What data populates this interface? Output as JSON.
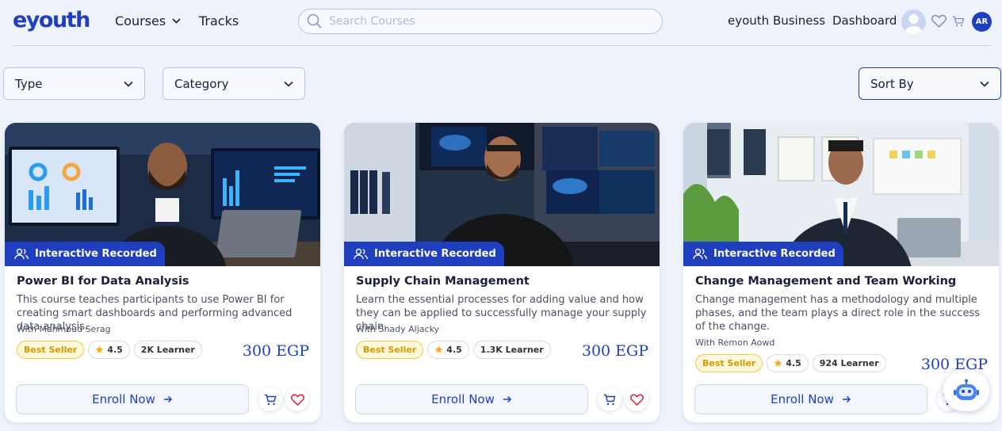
{
  "header": {
    "logo": "eyouth",
    "nav_courses": "Courses",
    "nav_tracks": "Tracks",
    "search_placeholder": "Search Courses",
    "business": "eyouth Business",
    "dashboard": "Dashboard",
    "user_initials": "AR"
  },
  "filters": {
    "type": "Type",
    "category": "Category",
    "sort": "Sort By"
  },
  "courses": [
    {
      "badge": "Interactive Recorded",
      "title": "Power BI for Data Analysis",
      "description": "This course teaches participants to use Power BI for creating smart dashboards and performing advanced data analysis.",
      "instructor": "With Mahmoud Serag",
      "tag": "Best Seller",
      "rating": "4.5",
      "learners": "2K Learner",
      "price": "300 EGP",
      "enroll": "Enroll Now"
    },
    {
      "badge": "Interactive Recorded",
      "title": "Supply Chain Management",
      "description": "Learn the essential processes for adding value and how they can be applied to successfully manage your supply chain.",
      "instructor": "With Shady Aljacky",
      "tag": "Best Seller",
      "rating": "4.5",
      "learners": "1.3K Learner",
      "price": "300 EGP",
      "enroll": "Enroll Now"
    },
    {
      "badge": "Interactive Recorded",
      "title": "Change Management and Team Working",
      "description": "Change management has a methodology and multiple phases, and the team plays a direct role in the success of the change.",
      "instructor": "With Remon Aowd",
      "tag": "Best Seller",
      "rating": "4.5",
      "learners": "924 Learner",
      "price": "300 EGP",
      "enroll": "Enroll Now"
    }
  ],
  "colors": {
    "brand": "#1f3fbf",
    "best_seller": "#d39a00",
    "heart": "#d62a45",
    "background": "#eef3fb"
  }
}
